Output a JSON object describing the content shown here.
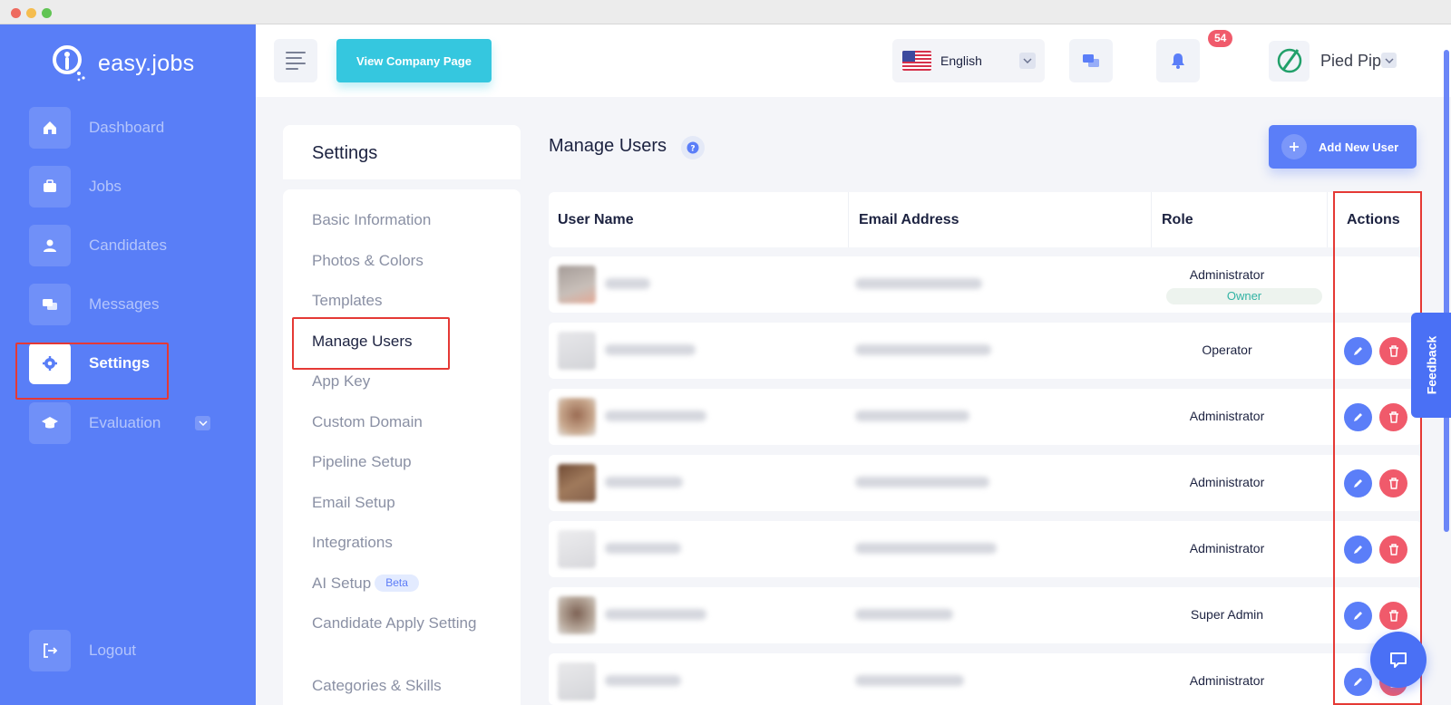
{
  "brand": {
    "name": "easy.jobs"
  },
  "sidebar": {
    "items": [
      {
        "label": "Dashboard",
        "icon": "home-icon"
      },
      {
        "label": "Jobs",
        "icon": "briefcase-icon"
      },
      {
        "label": "Candidates",
        "icon": "user-icon"
      },
      {
        "label": "Messages",
        "icon": "chat-icon"
      },
      {
        "label": "Settings",
        "icon": "gear-icon",
        "active": true
      },
      {
        "label": "Evaluation",
        "icon": "graduation-cap-icon"
      }
    ],
    "logout": {
      "label": "Logout",
      "icon": "logout-icon"
    }
  },
  "topbar": {
    "view_company_label": "View Company Page",
    "language": "English",
    "notifications_count": "54",
    "company_name": "Pied Pipe"
  },
  "settings_menu": {
    "title": "Settings",
    "items": [
      "Basic Information",
      "Photos & Colors",
      "Templates",
      "Manage Users",
      "App Key",
      "Custom Domain",
      "Pipeline Setup",
      "Email Setup",
      "Integrations",
      "AI Setup",
      "Candidate Apply Setting",
      "Categories & Skills"
    ],
    "active": "Manage Users",
    "beta_label": "Beta"
  },
  "main": {
    "title": "Manage Users",
    "add_button_label": "Add New User",
    "columns": [
      "User Name",
      "Email Address",
      "Role",
      "Actions"
    ],
    "rows": [
      {
        "role": "Administrator",
        "badge": "Owner"
      },
      {
        "role": "Operator"
      },
      {
        "role": "Administrator"
      },
      {
        "role": "Administrator"
      },
      {
        "role": "Administrator"
      },
      {
        "role": "Super Admin"
      },
      {
        "role": "Administrator"
      }
    ]
  },
  "feedback_label": "Feedback",
  "colors": {
    "sidebar": "#597ef7",
    "accent": "#5b7ef8",
    "cyan": "#35c7df",
    "danger": "#f05a6b",
    "highlight": "#e53935"
  }
}
